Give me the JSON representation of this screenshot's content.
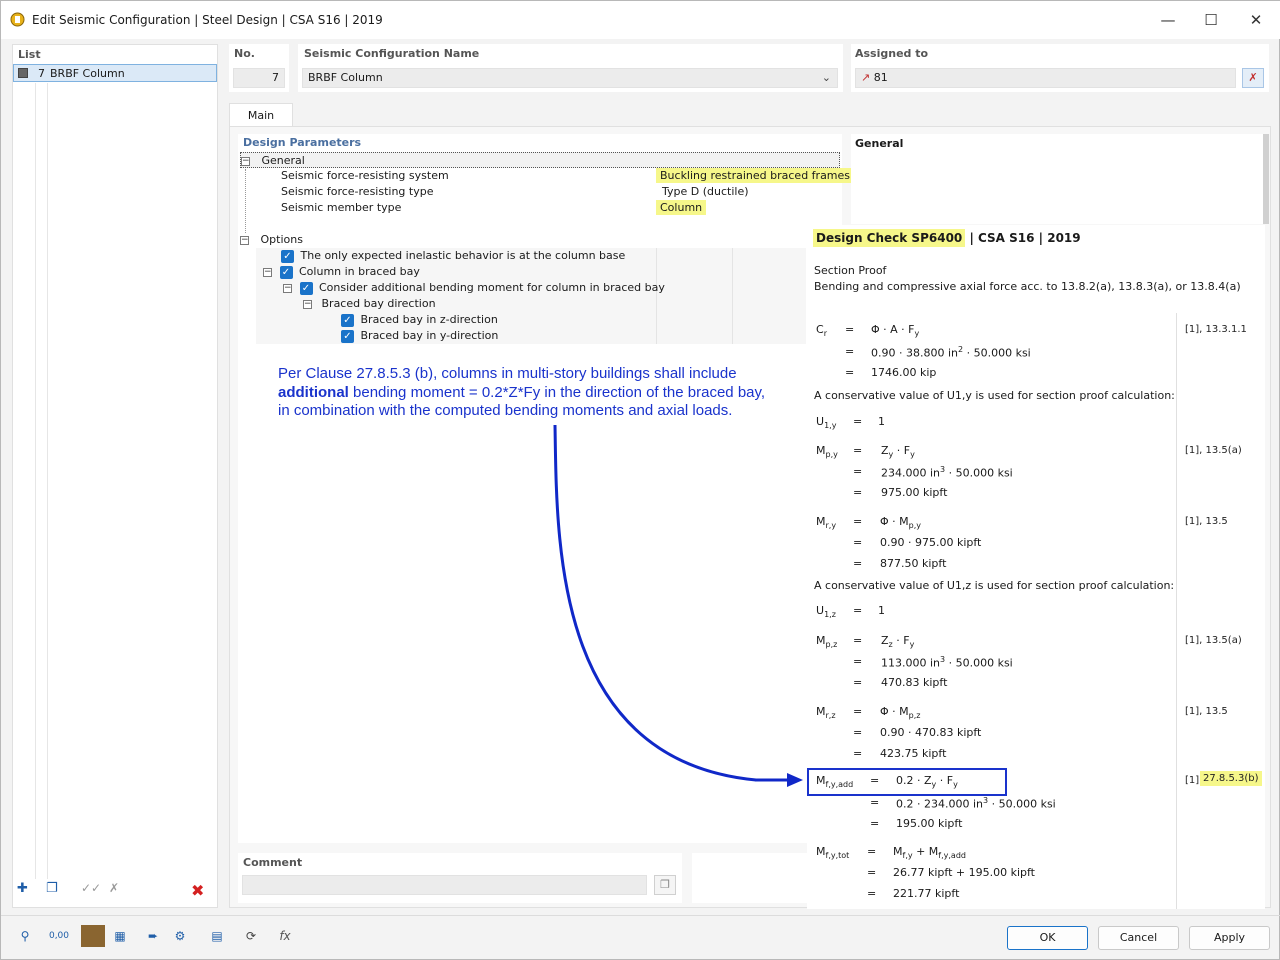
{
  "window": {
    "title": "Edit Seismic Configuration | Steel Design | CSA S16 | 2019"
  },
  "list": {
    "header": "List",
    "items": [
      {
        "no": "7",
        "name": "BRBF Column"
      }
    ]
  },
  "no": {
    "label": "No.",
    "value": "7"
  },
  "config_name": {
    "label": "Seismic Configuration Name",
    "value": "BRBF Column"
  },
  "assigned": {
    "label": "Assigned to",
    "value": "81"
  },
  "tabs": [
    "Main"
  ],
  "design_params": {
    "header": "Design Parameters",
    "general": {
      "label": "General",
      "rows": [
        {
          "label": "Seismic force-resisting system",
          "value": "Buckling restrained braced frames"
        },
        {
          "label": "Seismic force-resisting type",
          "value": "Type D (ductile)"
        },
        {
          "label": "Seismic member type",
          "value": "Column"
        }
      ]
    },
    "options": {
      "label": "Options",
      "rows": [
        "The only expected inelastic behavior is at the column base",
        "Column in braced bay",
        "Consider additional bending moment for column in braced bay",
        "Braced bay direction",
        "Braced bay in z-direction",
        "Braced bay in y-direction"
      ]
    }
  },
  "right_panel": {
    "header": "General"
  },
  "annotation": {
    "line1": "Per Clause 27.8.5.3 (b), columns in multi-story buildings shall include",
    "bold": "additional",
    "line2": " bending moment = 0.2*Z*Fy in the direction of the braced bay,",
    "line3": "in combination with the computed bending moments and axial loads."
  },
  "design_check": {
    "title": "Design Check SP6400",
    "standard": " | CSA S16 | 2019",
    "section": "Section Proof",
    "description": "Bending and compressive axial force acc. to 13.8.2(a), 13.8.3(a), or 13.8.4(a)",
    "conservative_y": "A conservative value of U1,y is used for section proof calculation:",
    "conservative_z": "A conservative value of U1,z is used for section proof calculation:",
    "refs": [
      "[1], 13.3.1.1",
      "[1], 13.5(a)",
      "[1], 13.5",
      "[1], 13.5(a)",
      "[1], 13.5",
      "[1], ",
      "27.8.5.3(b)"
    ],
    "values": {
      "cr_1": "0.90  ·  38.800 in",
      "cr_1b": "  ·  50.000 ksi",
      "cr_2": "1746.00 kip",
      "u1y": "1",
      "mpy_1": "234.000 in",
      "mpy_1b": "  ·  50.000 ksi",
      "mpy_2": "975.00 kipft",
      "mry_1": "0.90  ·  975.00 kipft",
      "mry_2": "877.50 kipft",
      "u1z": "1",
      "mpz_1": "113.000 in",
      "mpz_1b": "  ·  50.000 ksi",
      "mpz_2": "470.83 kipft",
      "mrz_1": "0.90  ·  470.83 kipft",
      "mrz_2": "423.75 kipft",
      "mfadd_0": "0.2",
      "mfadd_1": "0.2  ·  234.000 in",
      "mfadd_1b": "  ·  50.000 ksi",
      "mfadd_2": "195.00 kipft",
      "mftot_1": "26.77 kipft  +  195.00 kipft",
      "mftot_2": "221.77 kipft"
    }
  },
  "comment": {
    "label": "Comment",
    "value": ""
  },
  "buttons": {
    "ok": "OK",
    "cancel": "Cancel",
    "apply": "Apply"
  },
  "colors": {
    "accent": "#1a73c9",
    "highlight": "#f6f78a",
    "annotation": "#1a33cc",
    "arrow": "#1028c8"
  }
}
